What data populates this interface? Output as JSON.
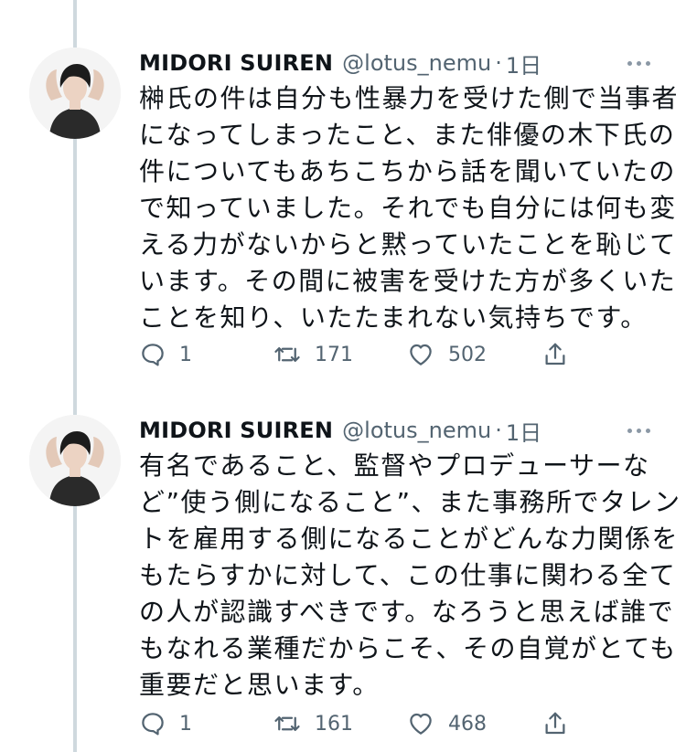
{
  "tweets": [
    {
      "author": {
        "name": "MIDORI SUIREN",
        "handle": "@lotus_nemu"
      },
      "time": "1日",
      "text_lines": [
        "榊氏の件は自分も性暴力を受けた側で当事者",
        "になってしまったこと、また俳優の木下氏の",
        "件についてもあちこちから話を聞いていたの",
        "で知っていました。それでも自分には何も変",
        "える力がないからと黙っていたことを恥じて",
        "います。その間に被害を受けた方が多くいた",
        "ことを知り、いたたまれない気持ちです。"
      ],
      "replies": "1",
      "retweets": "171",
      "likes": "502"
    },
    {
      "author": {
        "name": "MIDORI SUIREN",
        "handle": "@lotus_nemu"
      },
      "time": "1日",
      "text_lines": [
        "有名であること、監督やプロデューサーな",
        "ど”使う側になること”、また事務所でタレン",
        "トを雇用する側になることがどんな力関係を",
        "もたらすかに対して、この仕事に関わる全て",
        "の人が認識すべきです。なろうと思えば誰で",
        "もなれる業種だからこそ、その自覚がとても",
        "重要だと思います。"
      ],
      "replies": "1",
      "retweets": "161",
      "likes": "468"
    }
  ],
  "separator": "·",
  "icons": [
    "reply-icon",
    "retweet-icon",
    "like-icon",
    "share-icon",
    "more-icon"
  ],
  "colors": {
    "text": "#0f1419",
    "secondary": "#536471",
    "thread_line": "#cfd9de"
  }
}
